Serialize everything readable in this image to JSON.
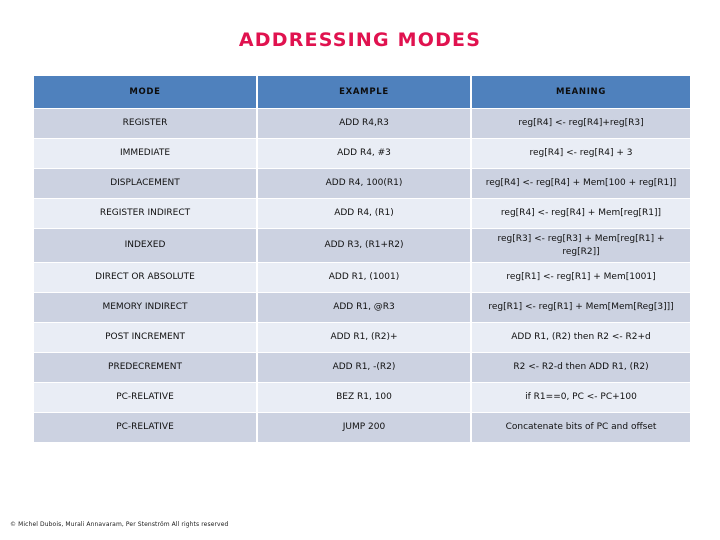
{
  "slide": {
    "title": "ADDRESSING MODES",
    "title_color": "#e0124f",
    "footer": "© Michel Dubois, Murali Annavaram, Per Stenström All rights reserved"
  },
  "table": {
    "header_bg": "#4f81bd",
    "row_dark_bg": "#ccd2e1",
    "row_light_bg": "#e9edf5",
    "columns": [
      "MODE",
      "EXAMPLE",
      "MEANING"
    ],
    "rows": [
      {
        "mode": "REGISTER",
        "example": "ADD R4,R3",
        "meaning": "reg[R4] <- reg[R4]+reg[R3]"
      },
      {
        "mode": "IMMEDIATE",
        "example": "ADD R4, #3",
        "meaning": "reg[R4] <- reg[R4] + 3"
      },
      {
        "mode": "DISPLACEMENT",
        "example": "ADD R4, 100(R1)",
        "meaning": "reg[R4] <- reg[R4] + Mem[100 + reg[R1]]"
      },
      {
        "mode": "REGISTER INDIRECT",
        "example": "ADD R4, (R1)",
        "meaning": "reg[R4] <- reg[R4] + Mem[reg[R1]]"
      },
      {
        "mode": "INDEXED",
        "example": "ADD R3, (R1+R2)",
        "meaning": "reg[R3] <- reg[R3] + Mem[reg[R1] + reg[R2]]"
      },
      {
        "mode": "DIRECT OR ABSOLUTE",
        "example": "ADD R1, (1001)",
        "meaning": "reg[R1] <- reg[R1] + Mem[1001]"
      },
      {
        "mode": "MEMORY INDIRECT",
        "example": "ADD R1, @R3",
        "meaning": "reg[R1] <- reg[R1] + Mem[Mem[Reg[3]]]"
      },
      {
        "mode": "POST INCREMENT",
        "example": "ADD R1, (R2)+",
        "meaning": "ADD R1, (R2) then R2 <- R2+d"
      },
      {
        "mode": "PREDECREMENT",
        "example": "ADD R1, -(R2)",
        "meaning": "R2 <- R2-d then ADD R1, (R2)"
      },
      {
        "mode": "PC-RELATIVE",
        "example": "BEZ R1, 100",
        "meaning": "if R1==0, PC <- PC+100"
      },
      {
        "mode": "PC-RELATIVE",
        "example": "JUMP 200",
        "meaning": "Concatenate bits of PC and offset"
      }
    ]
  }
}
